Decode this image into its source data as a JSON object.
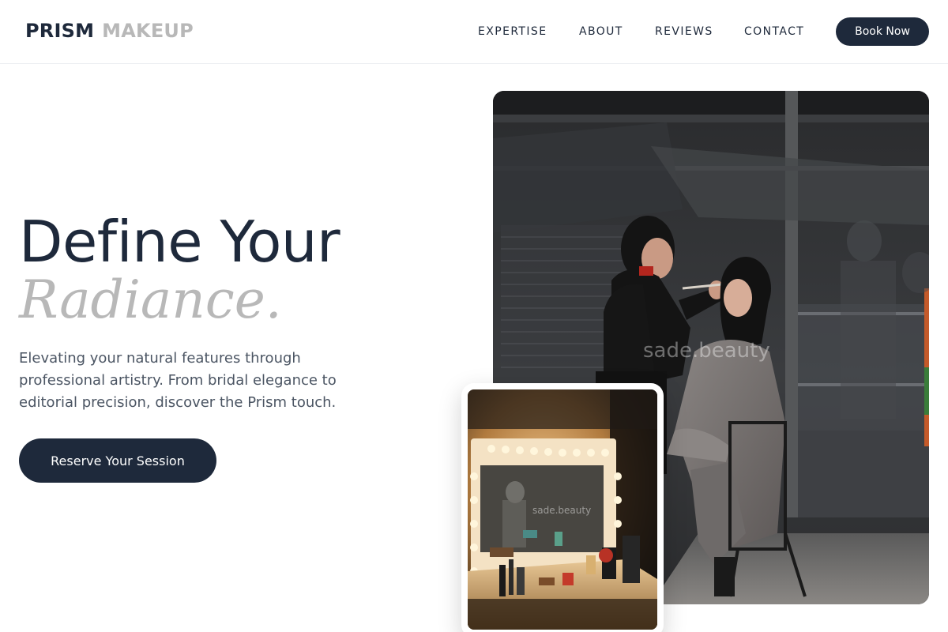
{
  "header": {
    "logo_primary": "PRISM",
    "logo_secondary": "MAKEUP",
    "nav": [
      {
        "label": "EXPERTISE"
      },
      {
        "label": "ABOUT"
      },
      {
        "label": "REVIEWS"
      },
      {
        "label": "CONTACT"
      }
    ],
    "book_label": "Book Now"
  },
  "hero": {
    "title": "Define Your",
    "title_italic": "Radiance.",
    "subtitle": "Elevating your natural features through professional artistry. From bridal elegance to editorial precision, discover the Prism touch.",
    "cta_label": "Reserve Your Session"
  },
  "images": {
    "main_watermark": "sade.beauty",
    "small_watermark": "sade.beauty"
  },
  "colors": {
    "primary": "#1e293b",
    "muted": "#b8b8b8",
    "body_text": "#4b5563"
  }
}
